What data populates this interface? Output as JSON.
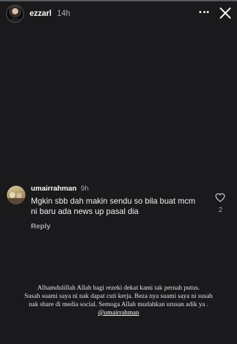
{
  "story": {
    "progress": 0,
    "header": {
      "username": "ezzarl",
      "time": "14h"
    }
  },
  "comment": {
    "username": "umairrahman",
    "time": "9h",
    "text": "Mgkin sbb dah makin sendu so bila buat mcm ni baru ada news up pasal dia",
    "reply_label": "Reply",
    "like_count": "2"
  },
  "caption": {
    "lines": [
      "Alhamdulillah Allah bagi rezeki dekat kami tak pernah putus.",
      "Susah suami saya ni nak dapat cuti kerja. Beza nya suami saya ni susah",
      "nak share di media social. Semoga Allah mudahkan urusan adik ya ."
    ],
    "mention": "@umairrahman"
  },
  "icons": {
    "more": "more-dots-icon",
    "close": "close-icon",
    "like": "heart-icon"
  },
  "colors": {
    "background": "#1a1a1c",
    "text": "#ffffff",
    "muted_text": "#a8a8ab"
  }
}
